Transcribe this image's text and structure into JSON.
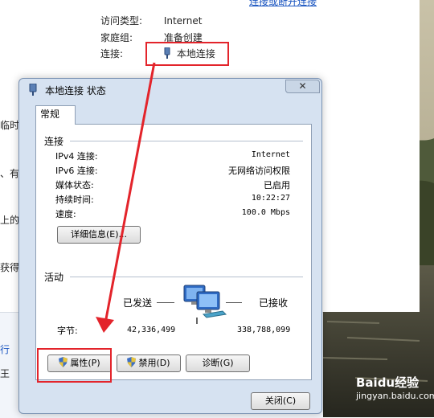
{
  "background": {
    "top_link": "连接或断开连接",
    "rows": [
      {
        "key": "访问类型:",
        "value": "Internet"
      },
      {
        "key": "家庭组:",
        "value": "准备创建"
      },
      {
        "key": "连接:",
        "value": "本地连接"
      }
    ],
    "left_fragments": [
      "临时",
      "、有",
      "上的",
      "获得",
      "行",
      "王"
    ]
  },
  "dialog": {
    "title": "本地连接 状态",
    "close_label": "✕",
    "tab_label": "常规",
    "connection_section": "连接",
    "connection_rows": [
      {
        "key": "IPv4 连接:",
        "value": "Internet"
      },
      {
        "key": "IPv6 连接:",
        "value": "无网络访问权限"
      },
      {
        "key": "媒体状态:",
        "value": "已启用"
      },
      {
        "key": "持续时间:",
        "value": "10:22:27"
      },
      {
        "key": "速度:",
        "value": "100.0 Mbps"
      }
    ],
    "details_button": "详细信息(E)...",
    "activity_section": "活动",
    "sent_label": "已发送",
    "received_label": "已接收",
    "bytes_label": "字节:",
    "bytes_sent": "42,336,499",
    "bytes_received": "338,788,099",
    "properties_button": "属性(P)",
    "disable_button": "禁用(D)",
    "diagnose_button": "诊断(G)",
    "close_button": "关闭(C)"
  },
  "watermark": {
    "logo": "Baidu经验",
    "url": "jingyan.baidu.com"
  },
  "colors": {
    "link": "#1a55c0",
    "annotation_red": "#e3242b",
    "dialog_frame": "#d6e2f1"
  }
}
